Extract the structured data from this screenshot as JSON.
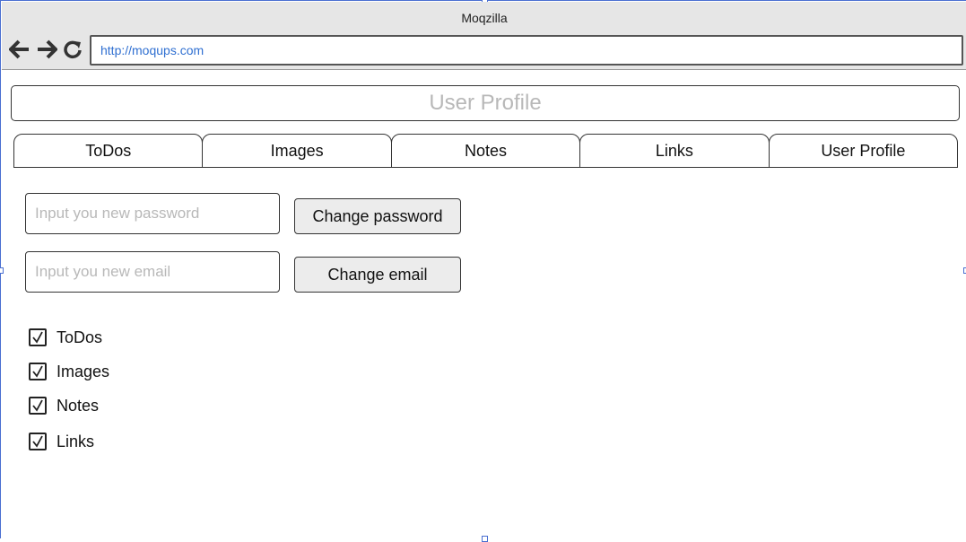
{
  "window": {
    "title": "Moqzilla",
    "url": "http://moqups.com"
  },
  "header": {
    "title": "User Profile"
  },
  "tabs": [
    {
      "label": "ToDos"
    },
    {
      "label": "Images"
    },
    {
      "label": "Notes"
    },
    {
      "label": "Links"
    },
    {
      "label": "User Profile"
    }
  ],
  "forms": {
    "password_placeholder": "Input you new password",
    "password_button": "Change password",
    "email_placeholder": "Input you new email",
    "email_button": "Change email"
  },
  "checkboxes": [
    {
      "label": "ToDos",
      "checked": true
    },
    {
      "label": "Images",
      "checked": true
    },
    {
      "label": "Notes",
      "checked": true
    },
    {
      "label": "Links",
      "checked": true
    }
  ],
  "icons": {
    "back": "arrow-left-icon",
    "forward": "arrow-right-icon",
    "reload": "reload-icon",
    "check": "checkmark-icon"
  },
  "colors": {
    "selection": "#4a6fd1",
    "url_text": "#2f6fd1",
    "placeholder": "#b8b8b8",
    "chrome": "#e6e6e6"
  }
}
